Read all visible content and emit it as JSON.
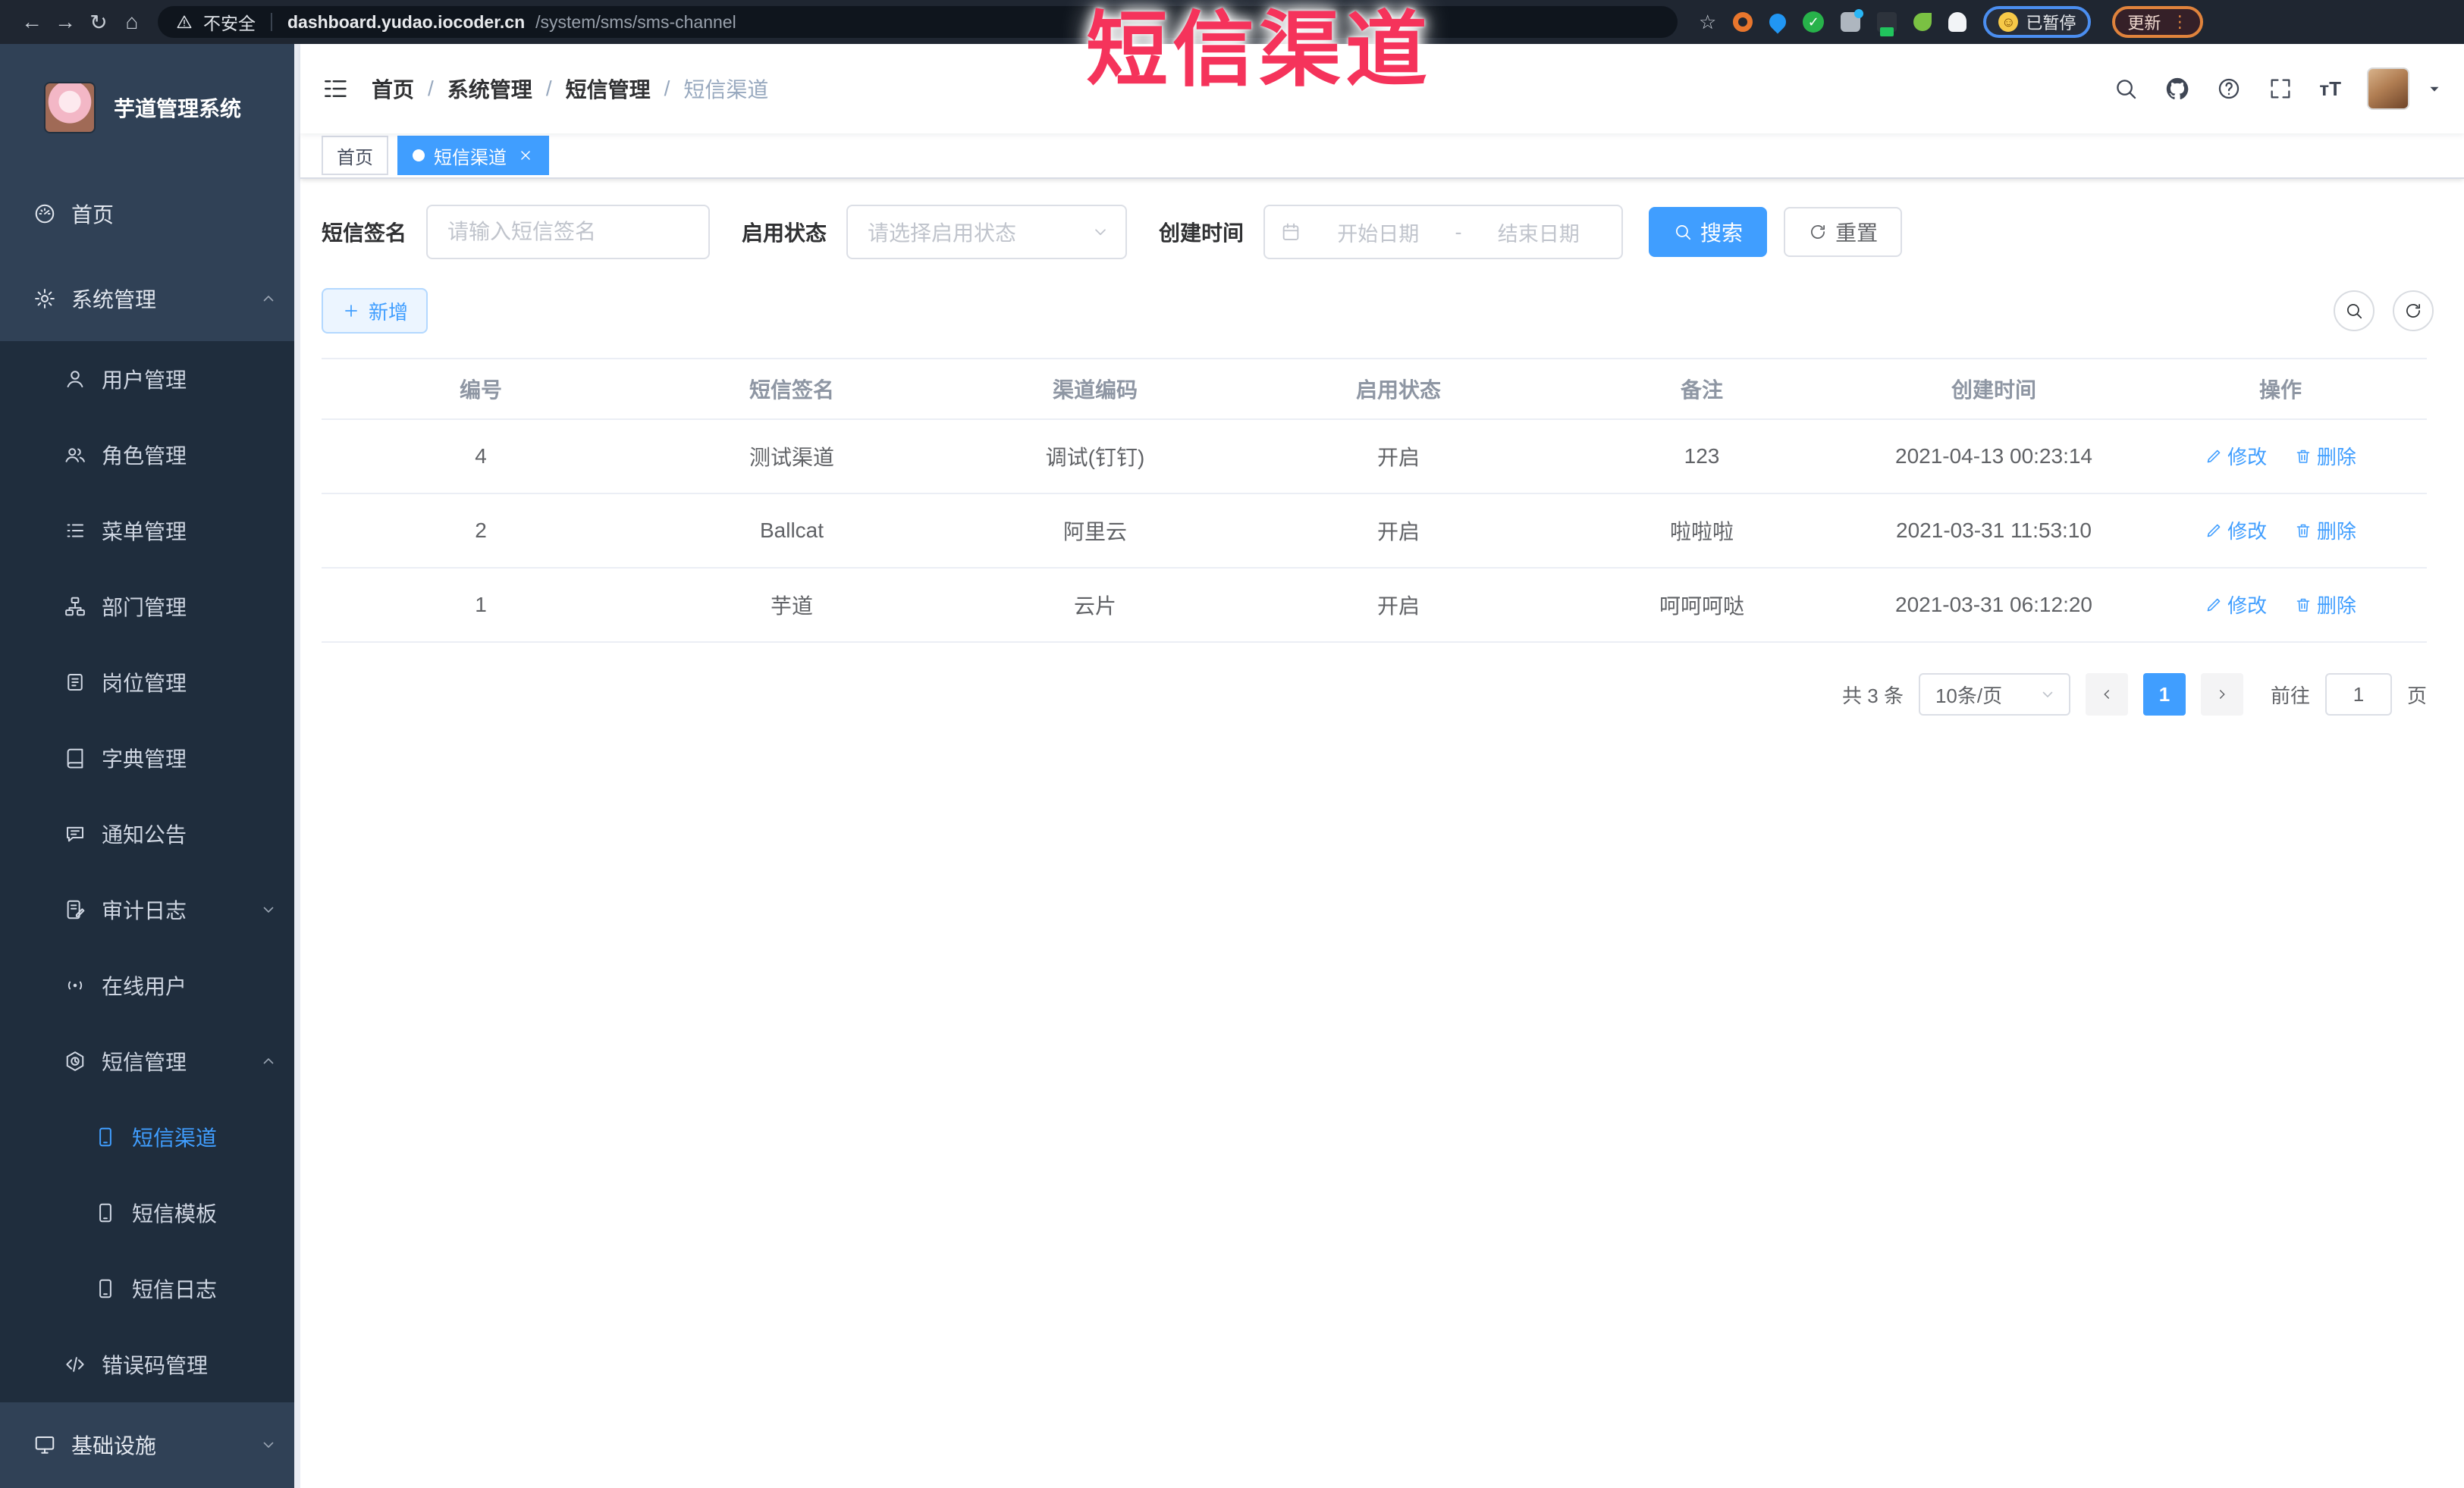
{
  "theme": {
    "primary": "#409EFF",
    "overlay-red": "#f5335b",
    "sidebar-bg": "#304156",
    "submenu-bg": "#1f2d3d"
  },
  "browser": {
    "security_label": "不安全",
    "url_host": "dashboard.yudao.iocoder.cn",
    "url_path": "/system/sms/sms-channel",
    "paused_label": "已暂停",
    "update_label": "更新"
  },
  "overlay": {
    "title": "短信渠道"
  },
  "sidebar": {
    "app_title": "芋道管理系统",
    "items": [
      {
        "label": "首页",
        "icon": "dashboard-icon",
        "level": 1
      },
      {
        "label": "系统管理",
        "icon": "gear-icon",
        "level": 1,
        "chevron": "up"
      },
      {
        "label": "用户管理",
        "icon": "user-icon",
        "level": 2
      },
      {
        "label": "角色管理",
        "icon": "users-icon",
        "level": 2
      },
      {
        "label": "菜单管理",
        "icon": "menu-list-icon",
        "level": 2
      },
      {
        "label": "部门管理",
        "icon": "tree-icon",
        "level": 2
      },
      {
        "label": "岗位管理",
        "icon": "id-card-icon",
        "level": 2
      },
      {
        "label": "字典管理",
        "icon": "book-icon",
        "level": 2
      },
      {
        "label": "通知公告",
        "icon": "announcement-icon",
        "level": 2
      },
      {
        "label": "审计日志",
        "icon": "log-icon",
        "level": 2,
        "chevron": "down"
      },
      {
        "label": "在线用户",
        "icon": "online-icon",
        "level": 2
      },
      {
        "label": "短信管理",
        "icon": "sms-icon",
        "level": 2,
        "chevron": "up"
      },
      {
        "label": "短信渠道",
        "icon": "phone-icon",
        "level": 3,
        "active": true
      },
      {
        "label": "短信模板",
        "icon": "phone-icon",
        "level": 3
      },
      {
        "label": "短信日志",
        "icon": "phone-icon",
        "level": 3
      },
      {
        "label": "错误码管理",
        "icon": "code-icon",
        "level": 2
      },
      {
        "label": "基础设施",
        "icon": "monitor-icon",
        "level": 1,
        "chevron": "down"
      }
    ]
  },
  "header": {
    "breadcrumb": [
      "首页",
      "系统管理",
      "短信管理",
      "短信渠道"
    ],
    "breadcrumb_separator": "/"
  },
  "tabs": {
    "items": [
      {
        "label": "首页",
        "active": false,
        "closable": false
      },
      {
        "label": "短信渠道",
        "active": true,
        "closable": true
      }
    ]
  },
  "filters": {
    "signature_label": "短信签名",
    "signature_placeholder": "请输入短信签名",
    "status_label": "启用状态",
    "status_placeholder": "请选择启用状态",
    "time_label": "创建时间",
    "date_start_placeholder": "开始日期",
    "date_separator": "-",
    "date_end_placeholder": "结束日期",
    "search_label": "搜索",
    "reset_label": "重置"
  },
  "toolbar": {
    "add_label": "新增"
  },
  "table": {
    "columns": [
      "编号",
      "短信签名",
      "渠道编码",
      "启用状态",
      "备注",
      "创建时间",
      "操作"
    ],
    "rows": [
      {
        "id": "4",
        "signature": "测试渠道",
        "code": "调试(钉钉)",
        "status": "开启",
        "remark": "123",
        "created": "2021-04-13 00:23:14"
      },
      {
        "id": "2",
        "signature": "Ballcat",
        "code": "阿里云",
        "status": "开启",
        "remark": "啦啦啦",
        "created": "2021-03-31 11:53:10"
      },
      {
        "id": "1",
        "signature": "芋道",
        "code": "云片",
        "status": "开启",
        "remark": "呵呵呵哒",
        "created": "2021-03-31 06:12:20"
      }
    ],
    "edit_label": "修改",
    "delete_label": "删除"
  },
  "pagination": {
    "total_label": "共 3 条",
    "page_size_label": "10条/页",
    "current_page": "1",
    "goto_label": "前往",
    "goto_value": "1",
    "page_unit_label": "页"
  }
}
